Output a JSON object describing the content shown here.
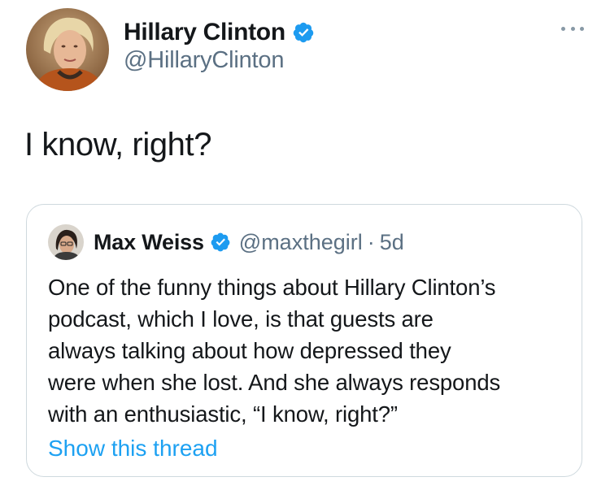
{
  "tweet": {
    "author": {
      "name": "Hillary Clinton",
      "handle": "@HillaryClinton",
      "verified": true
    },
    "more_icon": "more-horizontal-icon",
    "text": "I know, right?"
  },
  "quoted_tweet": {
    "author": {
      "name": "Max Weiss",
      "handle": "@maxthegirl",
      "verified": true
    },
    "dot": "·",
    "time": "5d",
    "lines": [
      "One of the funny things about Hillary Clinton’s",
      "podcast, which I love, is that guests are",
      "always talking about how depressed they",
      "were when she lost. And she always responds",
      "with an enthusiastic, “I know, right?”"
    ],
    "show_thread_label": "Show this thread"
  },
  "colors": {
    "verified_blue": "#1d9bf0",
    "link_blue": "#1da1f2",
    "secondary_text": "#5b7083",
    "border": "#cfd9de"
  }
}
